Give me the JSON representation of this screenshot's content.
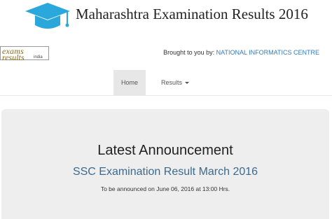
{
  "header": {
    "title": "Maharashtra Examination Results 2016",
    "logo_icon": "graduation-cap-icon",
    "logo_color": "#2aa8dc"
  },
  "partner": {
    "logo_line1": "exams",
    "logo_line2": "results",
    "logo_suffix": "india",
    "brought_by_label": "Brought to you by: ",
    "brought_by_link": "NATIONAL INFORMATICS CENTRE",
    "link_color": "#337ab7"
  },
  "nav": {
    "home": "Home",
    "results": "Results",
    "active_bg": "#e7e7e7"
  },
  "announcement": {
    "heading": "Latest Announcement",
    "title": "SSC Examination Result March 2016",
    "note": "To be announced on June 06, 2016 at 13:00 Hrs.",
    "title_color": "#3c6a8e",
    "panel_bg": "#eeeeee"
  }
}
